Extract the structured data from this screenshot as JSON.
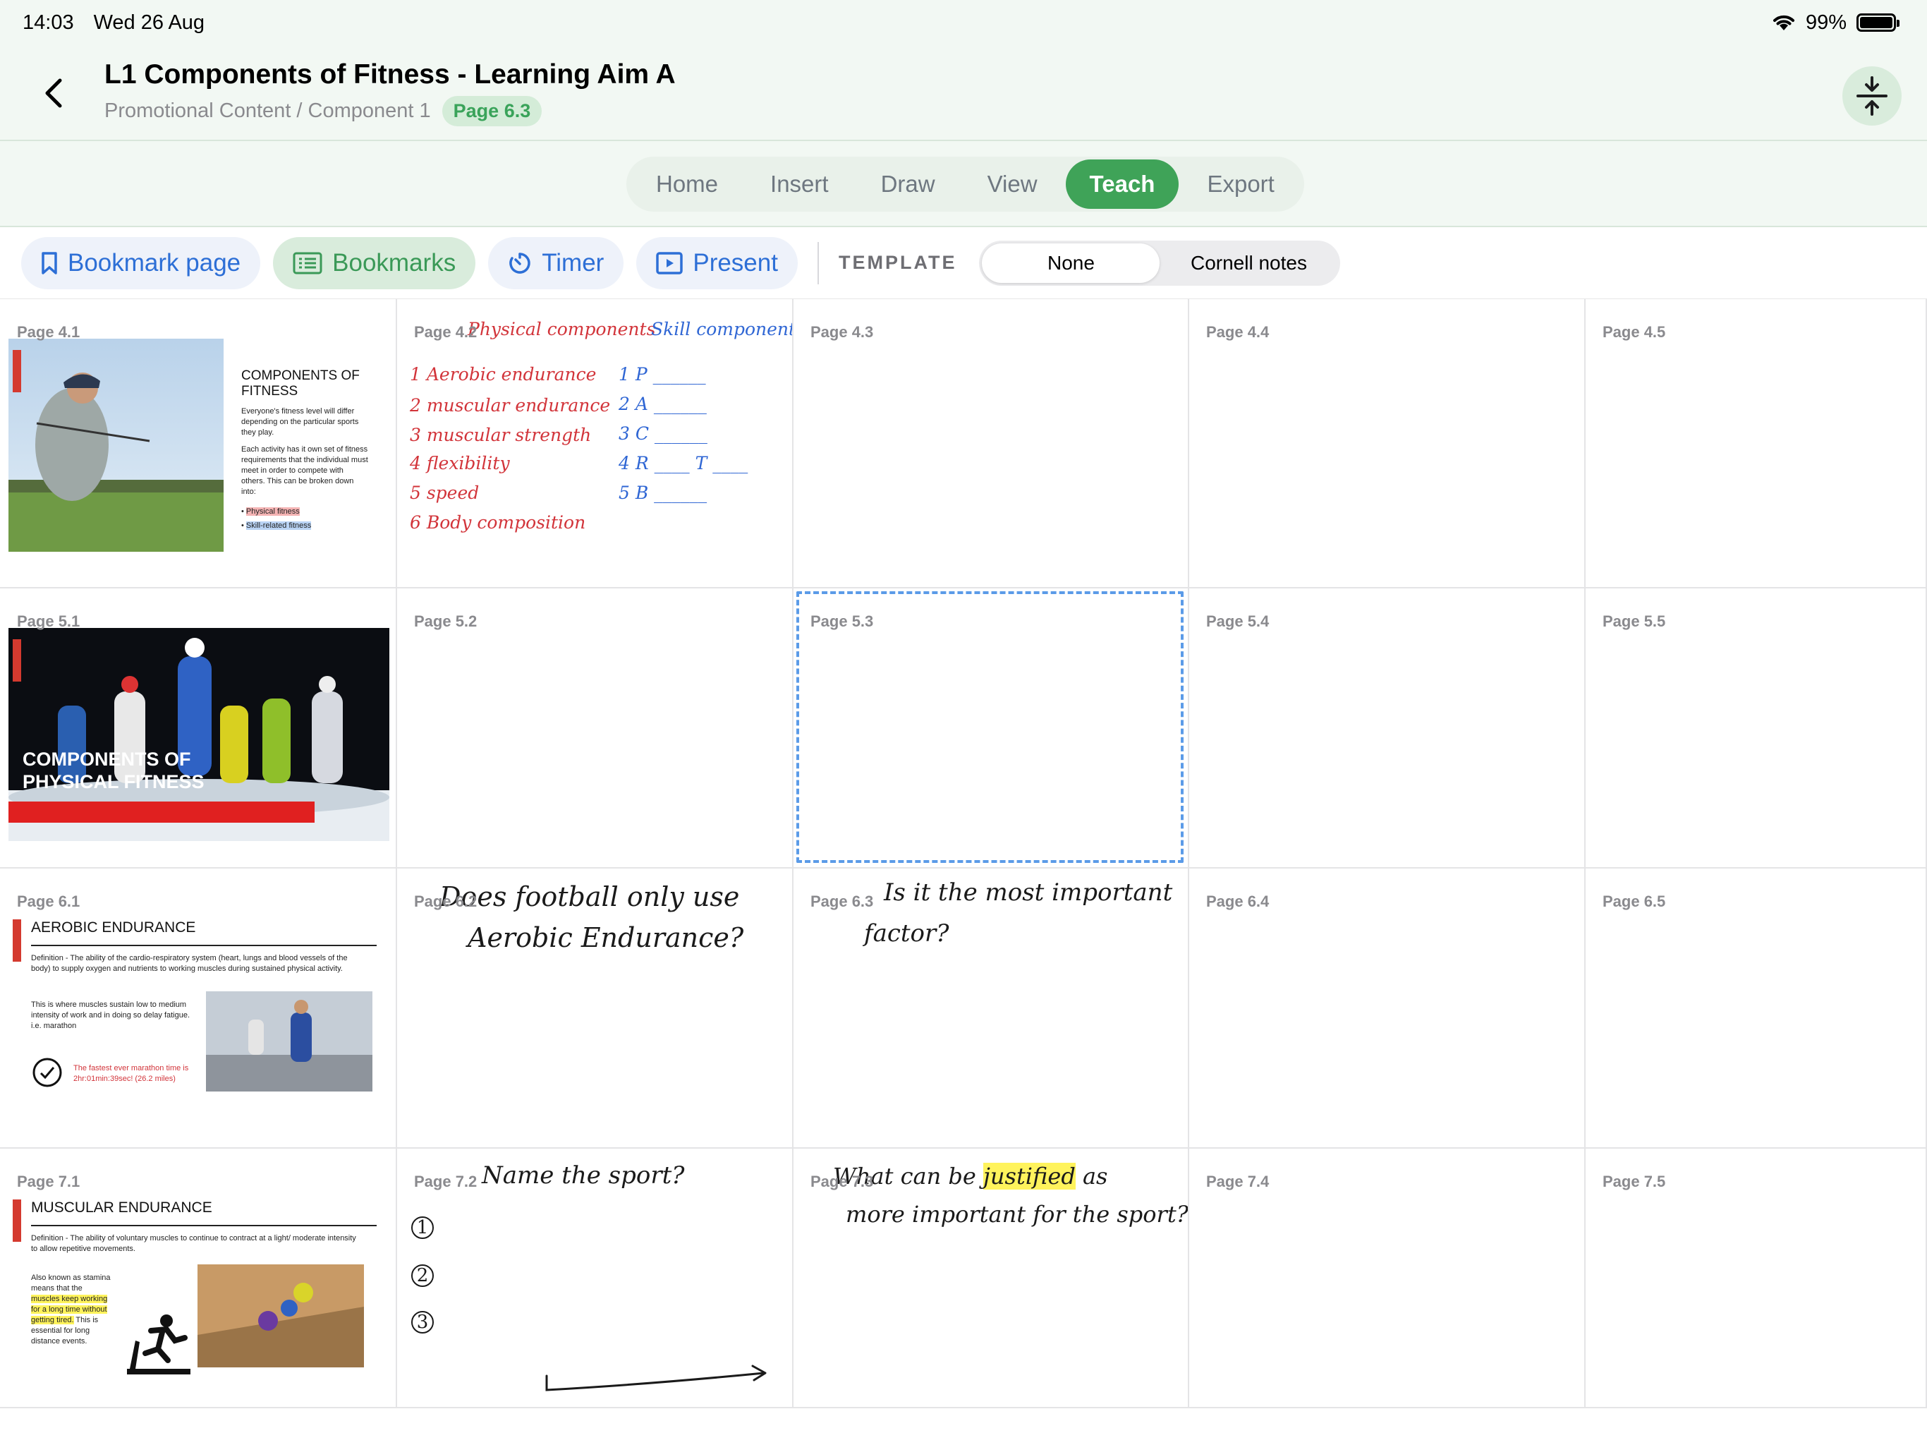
{
  "status": {
    "time": "14:03",
    "date": "Wed 26 Aug",
    "battery": "99%",
    "battery_level": 0.99
  },
  "header": {
    "title": "L1 Components of Fitness - Learning Aim A",
    "breadcrumb": "Promotional Content / Component 1",
    "page_badge": "Page 6.3"
  },
  "tabs": [
    {
      "label": "Home"
    },
    {
      "label": "Insert"
    },
    {
      "label": "Draw"
    },
    {
      "label": "View"
    },
    {
      "label": "Teach"
    },
    {
      "label": "Export"
    }
  ],
  "active_tab": "Teach",
  "toolbar": {
    "bookmark_page": "Bookmark page",
    "bookmarks": "Bookmarks",
    "timer": "Timer",
    "present": "Present",
    "template_label": "TEMPLATE",
    "template_options": [
      "None",
      "Cornell notes"
    ],
    "template_selected": "None"
  },
  "pages": {
    "p41": "Page 4.1",
    "p42": "Page 4.2",
    "p43": "Page 4.3",
    "p44": "Page 4.4",
    "p45": "Page 4.5",
    "p51": "Page 5.1",
    "p52": "Page 5.2",
    "p53": "Page 5.3",
    "p54": "Page 5.4",
    "p55": "Page 5.5",
    "p61": "Page 6.1",
    "p62": "Page 6.2",
    "p63": "Page 6.3",
    "p64": "Page 6.4",
    "p65": "Page 6.5",
    "p71": "Page 7.1",
    "p72": "Page 7.2",
    "p73": "Page 7.3",
    "p74": "Page 7.4",
    "p75": "Page 7.5"
  },
  "selected_page": "Page 5.3",
  "slides": {
    "s41": {
      "title": "COMPONENTS OF FITNESS",
      "text1": "Everyone's fitness level will differ depending on the particular sports they play.",
      "text2": "Each activity has it own set of fitness requirements that the individual must meet in order to compete with others. This can be broken down into:",
      "bullet1": "Physical fitness",
      "bullet2": "Skill-related fitness"
    },
    "s51": {
      "title": "COMPONENTS OF PHYSICAL FITNESS"
    },
    "s61": {
      "title": "AEROBIC ENDURANCE",
      "definition": "Definition - The ability of the cardio-respiratory system (heart, lungs and blood vessels of the body) to supply oxygen and nutrients to working muscles during sustained physical activity.",
      "text": "This is where muscles sustain low to medium intensity of work and in doing so delay fatigue. i.e. marathon",
      "fact": "The fastest ever marathon time is 2hr:01min:39sec! (26.2 miles)"
    },
    "s71": {
      "title": "MUSCULAR ENDURANCE",
      "definition": "Definition - The ability of voluntary muscles to continue to contract at a light/ moderate intensity to allow repetitive movements.",
      "text_a": "Also known as stamina means that the",
      "text_hl": "muscles keep working for a long time without getting tired.",
      "text_b": "This is essential for long distance events."
    }
  },
  "notes": {
    "n42": {
      "head_left": "Physical components",
      "head_right": "Skill components",
      "left": [
        "1  Aerobic endurance",
        "2  muscular endurance",
        "3  muscular strength",
        "4  flexibility",
        "5  speed",
        "6  Body composition"
      ],
      "right": [
        "1  P ______",
        "2  A ______",
        "3  C ______",
        "4  R ____ T ____",
        "5  B ______"
      ]
    },
    "n62": {
      "line1": "Does football only use",
      "line2": "Aerobic Endurance?"
    },
    "n63": {
      "line1": "Is it the most important",
      "line2": "factor?"
    },
    "n72": {
      "line1": "Name the sport?",
      "items": [
        "1",
        "2",
        "3"
      ]
    },
    "n73": {
      "line1a": "What can be",
      "line1hl": "justified",
      "line1b": "as",
      "line2": "more important for the sport?"
    }
  },
  "colors": {
    "accent_green": "#3fa358",
    "link_blue": "#2d6fd6",
    "ink_red": "#d2343a",
    "ink_blue": "#2f66d4",
    "highlight_yellow": "#fff35c"
  },
  "icons": [
    "back-chevron-icon",
    "wifi-icon",
    "battery-icon",
    "collapse-icon",
    "bookmark-icon",
    "list-icon",
    "timer-icon",
    "present-icon"
  ]
}
